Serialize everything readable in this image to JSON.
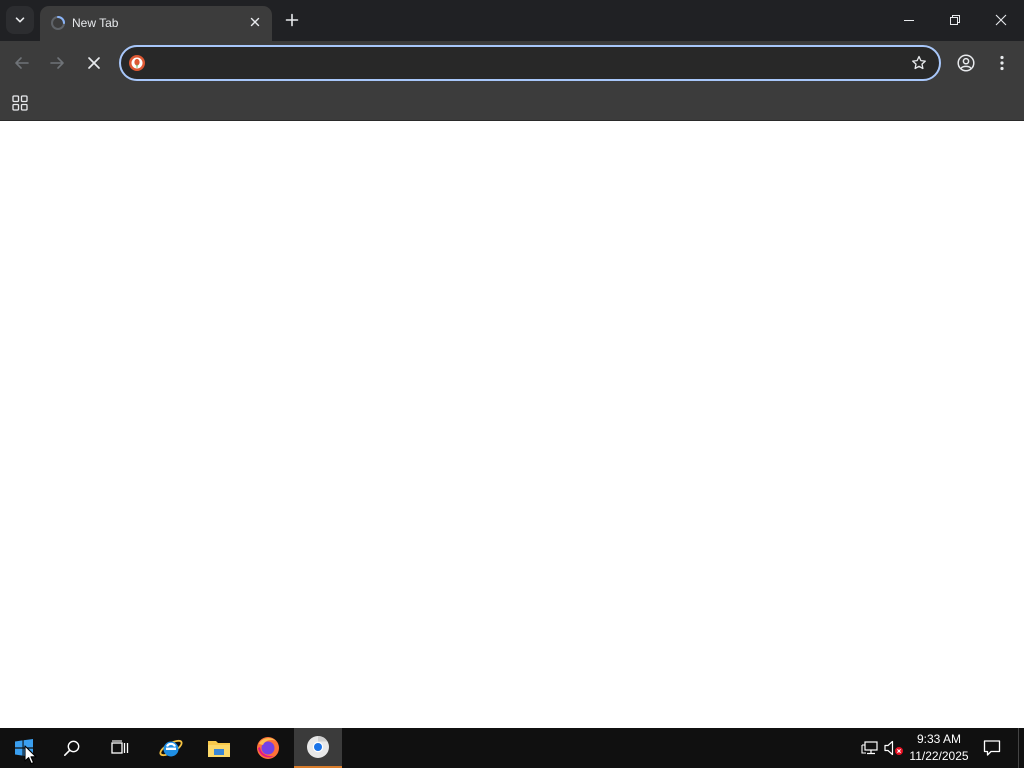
{
  "browser": {
    "tab": {
      "title": "New Tab",
      "favicon": "loading-spinner-icon"
    },
    "omnibox": {
      "value": "",
      "placeholder": "",
      "security_icon": "duckduckgo-icon"
    },
    "colors": {
      "titlebar": "#202124",
      "toolbar": "#3c3c3c",
      "omnibox_focus": "#a8c7fa"
    }
  },
  "taskbar": {
    "items": [
      "start-icon",
      "search-icon",
      "task-view-icon",
      "internet-explorer-icon",
      "file-explorer-icon",
      "firefox-icon",
      "chrome-icon"
    ],
    "active_item": "chrome-icon",
    "clock": {
      "time": "9:33 AM",
      "date": "11/22/2025"
    }
  }
}
